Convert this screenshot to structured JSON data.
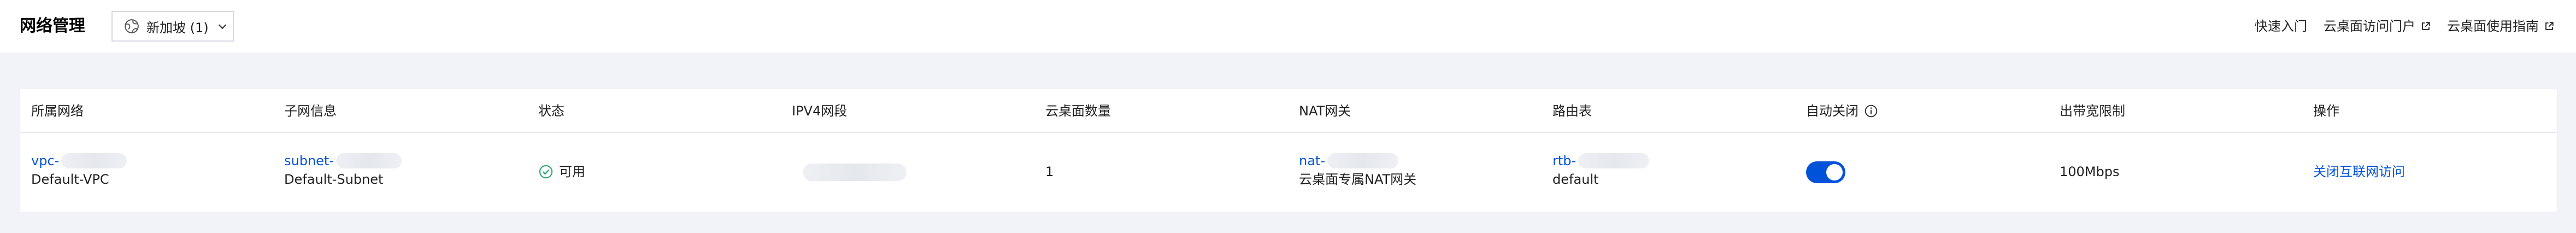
{
  "header": {
    "title": "网络管理",
    "region_value": "新加坡 (1)",
    "links": [
      {
        "label": "快速入门",
        "external": false
      },
      {
        "label": "云桌面访问门户",
        "external": true
      },
      {
        "label": "云桌面使用指南",
        "external": true
      }
    ]
  },
  "table": {
    "columns": [
      "所属网络",
      "子网信息",
      "状态",
      "IPV4网段",
      "云桌面数量",
      "NAT网关",
      "路由表",
      "自动关闭",
      "出带宽限制",
      "操作"
    ],
    "rows": [
      {
        "network_id_prefix": "vpc-",
        "network_name": "Default-VPC",
        "subnet_id_prefix": "subnet-",
        "subnet_name": "Default-Subnet",
        "status": "可用",
        "desktop_count": "1",
        "nat_id_prefix": "nat-",
        "nat_name": "云桌面专属NAT网关",
        "route_id_prefix": "rtb-",
        "route_name": "default",
        "auto_close_on": true,
        "bandwidth": "100Mbps",
        "action": "关闭互联网访问"
      }
    ]
  },
  "colors": {
    "accent": "#0052d9",
    "success": "#2ba471",
    "page_bg": "#f1f3f8"
  },
  "icons": [
    "globe-icon",
    "chevron-down-icon",
    "external-link-icon",
    "info-icon",
    "check-circle-icon"
  ]
}
